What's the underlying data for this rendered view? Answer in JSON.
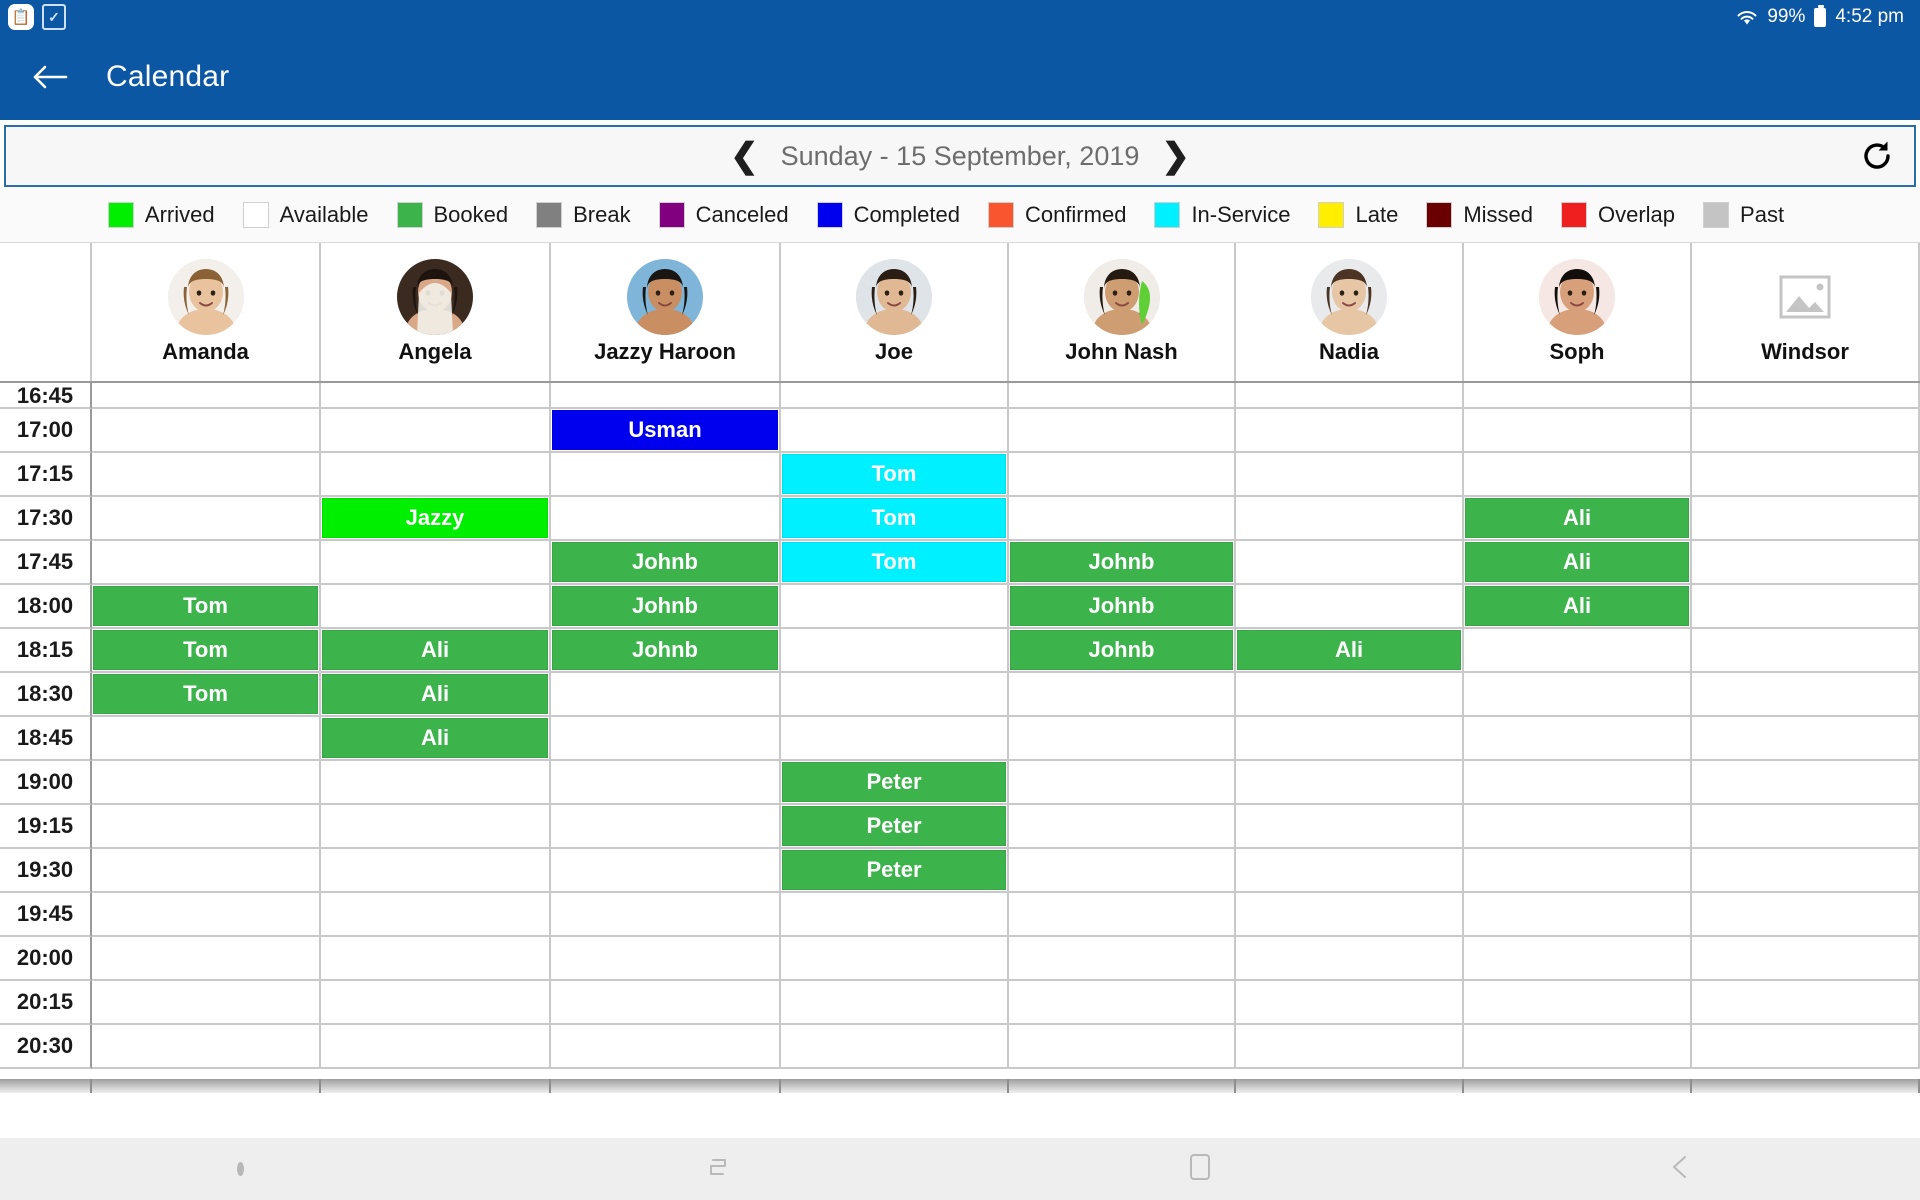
{
  "status_bar": {
    "notification_icons": [
      "clipboard-icon",
      "checkbox-icon"
    ],
    "wifi_icon": "wifi-icon",
    "battery_text": "99%",
    "battery_icon": "battery-icon",
    "time": "4:52 pm"
  },
  "app_bar": {
    "back_icon": "back-arrow-icon",
    "title": "Calendar",
    "background": "#0b57a4"
  },
  "date_bar": {
    "prev_icon": "chevron-left-icon",
    "date": "Sunday - 15 September, 2019",
    "next_icon": "chevron-right-icon",
    "refresh_icon": "refresh-icon"
  },
  "legend": [
    {
      "label": "Arrived",
      "color": "#00ee00"
    },
    {
      "label": "Available",
      "color": "#ffffff"
    },
    {
      "label": "Booked",
      "color": "#3cb44b"
    },
    {
      "label": "Break",
      "color": "#808080"
    },
    {
      "label": "Canceled",
      "color": "#800080"
    },
    {
      "label": "Completed",
      "color": "#0000ee"
    },
    {
      "label": "Confirmed",
      "color": "#f9562f"
    },
    {
      "label": "In-Service",
      "color": "#00f0ff"
    },
    {
      "label": "Late",
      "color": "#ffee00"
    },
    {
      "label": "Missed",
      "color": "#6b0000"
    },
    {
      "label": "Overlap",
      "color": "#f01f1f"
    },
    {
      "label": "Past",
      "color": "#c4c4c4"
    }
  ],
  "staff": [
    {
      "name": "Amanda",
      "avatar": "photo-avatar"
    },
    {
      "name": "Angela",
      "avatar": "photo-avatar"
    },
    {
      "name": "Jazzy Haroon",
      "avatar": "photo-avatar"
    },
    {
      "name": "Joe",
      "avatar": "photo-avatar"
    },
    {
      "name": "John  Nash",
      "avatar": "photo-avatar"
    },
    {
      "name": "Nadia",
      "avatar": "photo-avatar"
    },
    {
      "name": "Soph",
      "avatar": "photo-avatar"
    },
    {
      "name": "Windsor",
      "avatar": "placeholder-image-icon"
    }
  ],
  "times": [
    "16:45",
    "17:00",
    "17:15",
    "17:30",
    "17:45",
    "18:00",
    "18:15",
    "18:30",
    "18:45",
    "19:00",
    "19:15",
    "19:30",
    "19:45",
    "20:00",
    "20:15",
    "20:30"
  ],
  "appointments": [
    {
      "time": "17:00",
      "staff": "Jazzy Haroon",
      "label": "Usman",
      "status": "Completed",
      "color": "#0000ee"
    },
    {
      "time": "17:15",
      "staff": "Joe",
      "label": "Tom",
      "status": "In-Service",
      "color": "#00f0ff"
    },
    {
      "time": "17:30",
      "staff": "Angela",
      "label": "Jazzy",
      "status": "Arrived",
      "color": "#00ee00"
    },
    {
      "time": "17:30",
      "staff": "Joe",
      "label": "Tom",
      "status": "In-Service",
      "color": "#00f0ff"
    },
    {
      "time": "17:30",
      "staff": "Soph",
      "label": "Ali",
      "status": "Booked",
      "color": "#3cb44b"
    },
    {
      "time": "17:45",
      "staff": "Jazzy Haroon",
      "label": "Johnb",
      "status": "Booked",
      "color": "#3cb44b"
    },
    {
      "time": "17:45",
      "staff": "Joe",
      "label": "Tom",
      "status": "In-Service",
      "color": "#00f0ff"
    },
    {
      "time": "17:45",
      "staff": "John  Nash",
      "label": "Johnb",
      "status": "Booked",
      "color": "#3cb44b"
    },
    {
      "time": "17:45",
      "staff": "Soph",
      "label": "Ali",
      "status": "Booked",
      "color": "#3cb44b"
    },
    {
      "time": "18:00",
      "staff": "Amanda",
      "label": "Tom",
      "status": "Booked",
      "color": "#3cb44b"
    },
    {
      "time": "18:00",
      "staff": "Jazzy Haroon",
      "label": "Johnb",
      "status": "Booked",
      "color": "#3cb44b"
    },
    {
      "time": "18:00",
      "staff": "John  Nash",
      "label": "Johnb",
      "status": "Booked",
      "color": "#3cb44b"
    },
    {
      "time": "18:00",
      "staff": "Soph",
      "label": "Ali",
      "status": "Booked",
      "color": "#3cb44b"
    },
    {
      "time": "18:15",
      "staff": "Amanda",
      "label": "Tom",
      "status": "Booked",
      "color": "#3cb44b"
    },
    {
      "time": "18:15",
      "staff": "Angela",
      "label": "Ali",
      "status": "Booked",
      "color": "#3cb44b"
    },
    {
      "time": "18:15",
      "staff": "Jazzy Haroon",
      "label": "Johnb",
      "status": "Booked",
      "color": "#3cb44b"
    },
    {
      "time": "18:15",
      "staff": "John  Nash",
      "label": "Johnb",
      "status": "Booked",
      "color": "#3cb44b"
    },
    {
      "time": "18:15",
      "staff": "Nadia",
      "label": "Ali",
      "status": "Booked",
      "color": "#3cb44b"
    },
    {
      "time": "18:30",
      "staff": "Amanda",
      "label": "Tom",
      "status": "Booked",
      "color": "#3cb44b"
    },
    {
      "time": "18:30",
      "staff": "Angela",
      "label": "Ali",
      "status": "Booked",
      "color": "#3cb44b"
    },
    {
      "time": "18:45",
      "staff": "Angela",
      "label": "Ali",
      "status": "Booked",
      "color": "#3cb44b"
    },
    {
      "time": "19:00",
      "staff": "Joe",
      "label": "Peter",
      "status": "Booked",
      "color": "#3cb44b"
    },
    {
      "time": "19:15",
      "staff": "Joe",
      "label": "Peter",
      "status": "Booked",
      "color": "#3cb44b"
    },
    {
      "time": "19:30",
      "staff": "Joe",
      "label": "Peter",
      "status": "Booked",
      "color": "#3cb44b"
    }
  ],
  "nav_bar": {
    "items": [
      {
        "icon": "dot-indicator-icon"
      },
      {
        "icon": "recents-icon"
      },
      {
        "icon": "home-icon"
      },
      {
        "icon": "back-icon"
      }
    ]
  }
}
